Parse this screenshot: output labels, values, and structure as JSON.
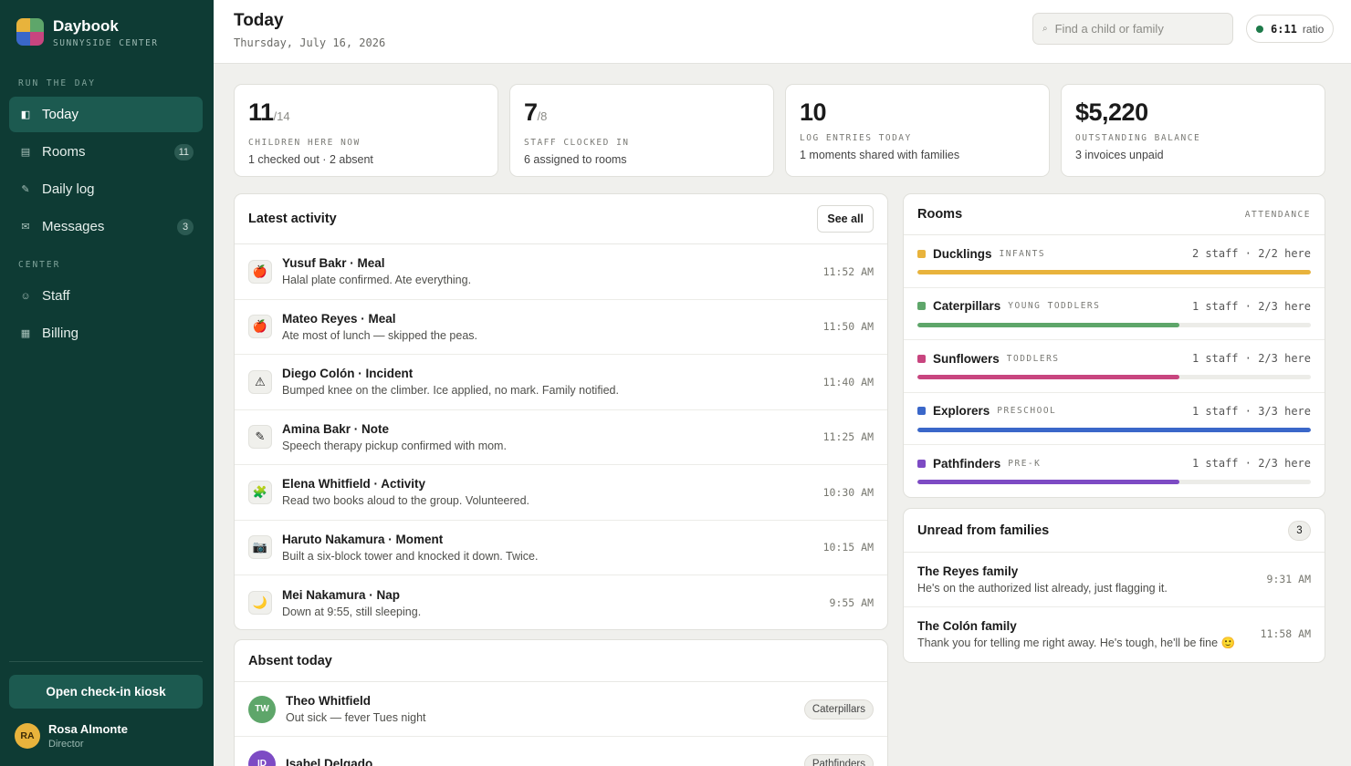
{
  "brand": {
    "name": "Daybook",
    "subtitle": "SUNNYSIDE CENTER"
  },
  "sidebar": {
    "sections": [
      "RUN THE DAY",
      "CENTER"
    ],
    "items": [
      {
        "label": "Today",
        "icon": "today-icon",
        "glyph": "◧",
        "badge": "",
        "active": true
      },
      {
        "label": "Rooms",
        "icon": "rooms-icon",
        "glyph": "▤",
        "badge": "11",
        "active": false
      },
      {
        "label": "Daily log",
        "icon": "pencil-icon",
        "glyph": "✎",
        "badge": "",
        "active": false
      },
      {
        "label": "Messages",
        "icon": "envelope-icon",
        "glyph": "✉",
        "badge": "3",
        "active": false
      },
      {
        "label": "Staff",
        "icon": "smiley-icon",
        "glyph": "☺",
        "badge": "",
        "active": false
      },
      {
        "label": "Billing",
        "icon": "grid-icon",
        "glyph": "▦",
        "badge": "",
        "active": false
      }
    ],
    "kiosk_label": "Open check-in kiosk",
    "user": {
      "initials": "RA",
      "name": "Rosa Almonte",
      "role": "Director"
    }
  },
  "header": {
    "title": "Today",
    "date": "Thursday, July 16, 2026",
    "search_placeholder": "Find a child or family",
    "ratio_value": "6:11",
    "ratio_label": "ratio"
  },
  "stats": [
    {
      "value": "11",
      "of": "/14",
      "caption": "CHILDREN HERE NOW",
      "sub": "1 checked out · 2 absent"
    },
    {
      "value": "7",
      "of": "/8",
      "caption": "STAFF CLOCKED IN",
      "sub": "6 assigned to rooms"
    },
    {
      "value": "10",
      "of": "",
      "caption": "LOG ENTRIES TODAY",
      "sub": "1 moments shared with families"
    },
    {
      "value": "$5,220",
      "of": "",
      "caption": "OUTSTANDING BALANCE",
      "sub": "3 invoices unpaid"
    }
  ],
  "activity": {
    "title": "Latest activity",
    "see_all": "See all",
    "items": [
      {
        "title": "Yusuf Bakr · Meal",
        "desc": "Halal plate confirmed. Ate everything.",
        "time": "11:52 AM",
        "icon": "apple-icon",
        "glyph": "🍎"
      },
      {
        "title": "Mateo Reyes · Meal",
        "desc": "Ate most of lunch — skipped the peas.",
        "time": "11:50 AM",
        "icon": "apple-icon",
        "glyph": "🍎"
      },
      {
        "title": "Diego Colón · Incident",
        "desc": "Bumped knee on the climber. Ice applied, no mark. Family notified.",
        "time": "11:40 AM",
        "icon": "warning-icon",
        "glyph": "⚠"
      },
      {
        "title": "Amina Bakr · Note",
        "desc": "Speech therapy pickup confirmed with mom.",
        "time": "11:25 AM",
        "icon": "pencil-icon",
        "glyph": "✎"
      },
      {
        "title": "Elena Whitfield · Activity",
        "desc": "Read two books aloud to the group. Volunteered.",
        "time": "10:30 AM",
        "icon": "puzzle-icon",
        "glyph": "🧩"
      },
      {
        "title": "Haruto Nakamura · Moment",
        "desc": "Built a six-block tower and knocked it down. Twice.",
        "time": "10:15 AM",
        "icon": "camera-icon",
        "glyph": "📷"
      },
      {
        "title": "Mei Nakamura · Nap",
        "desc": "Down at 9:55, still sleeping.",
        "time": "9:55 AM",
        "icon": "moon-icon",
        "glyph": "🌙"
      }
    ]
  },
  "absent": {
    "title": "Absent today",
    "items": [
      {
        "initials": "TW",
        "name": "Theo Whitfield",
        "reason": "Out sick — fever Tues night",
        "room": "Caterpillars",
        "color": "#5ea66a"
      },
      {
        "initials": "ID",
        "name": "Isabel Delgado",
        "reason": "",
        "room": "Pathfinders",
        "color": "#7d4bc4"
      }
    ]
  },
  "rooms": {
    "title": "Rooms",
    "tag": "ATTENDANCE",
    "items": [
      {
        "name": "Ducklings",
        "age": "INFANTS",
        "stat": "2 staff · 2/2 here",
        "fill": 1.0,
        "color": "#e8b33c"
      },
      {
        "name": "Caterpillars",
        "age": "YOUNG TODDLERS",
        "stat": "1 staff · 2/3 here",
        "fill": 0.667,
        "color": "#5ea66a"
      },
      {
        "name": "Sunflowers",
        "age": "TODDLERS",
        "stat": "1 staff · 2/3 here",
        "fill": 0.667,
        "color": "#c8457f"
      },
      {
        "name": "Explorers",
        "age": "PRESCHOOL",
        "stat": "1 staff · 3/3 here",
        "fill": 1.0,
        "color": "#3a67c9"
      },
      {
        "name": "Pathfinders",
        "age": "PRE-K",
        "stat": "1 staff · 2/3 here",
        "fill": 0.667,
        "color": "#7d4bc4"
      }
    ]
  },
  "unread": {
    "title": "Unread from families",
    "count": "3",
    "items": [
      {
        "from": "The Reyes family",
        "text": "He's on the authorized list already, just flagging it.",
        "time": "9:31 AM"
      },
      {
        "from": "The Colón family",
        "text": "Thank you for telling me right away. He's tough, he'll be fine 🙂",
        "time": "11:58 AM"
      }
    ]
  }
}
